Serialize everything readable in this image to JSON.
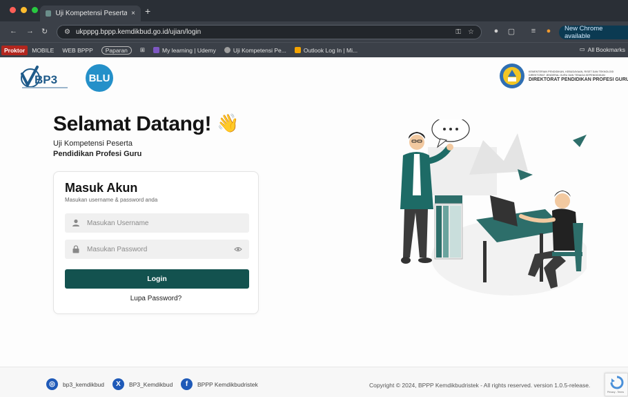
{
  "browser": {
    "tab_title": "Uji Kompetensi Peserta PPG",
    "tab_close": "×",
    "new_tab": "+",
    "url": "ukpppg.bppp.kemdikbud.go.id/ujian/login",
    "new_chrome": "New Chrome available",
    "all_bookmarks": "All Bookmarks",
    "bookmarks": [
      {
        "label": "Proktor",
        "style": "red"
      },
      {
        "label": "MOBILE",
        "style": "plain"
      },
      {
        "label": "WEB BPPP",
        "style": "plain"
      },
      {
        "label": "Paparan",
        "style": "pill"
      },
      {
        "label": "My learning | Udemy",
        "style": "icon",
        "color": "#7e57c2"
      },
      {
        "label": "Uji Kompetensi Pe...",
        "style": "icon",
        "color": "#9e9e9e"
      },
      {
        "label": "Outlook Log In | Mi...",
        "style": "icon",
        "color": "#f4a300"
      }
    ]
  },
  "header": {
    "bp3_text": "BP3",
    "blu_text": "BLU",
    "kemdik_line1": "KEMENTERIAN PENDIDIKAN, KEBUDAYAAN, RISET DAN TEKNOLOGI",
    "kemdik_line2": "DIREKTORAT JENDERAL GURU DAN TENAGA KEPENDIDIKAN",
    "kemdik_line3": "DIREKTORAT PENDIDIKAN PROFESI GURU"
  },
  "hero": {
    "welcome": "Selamat Datang!",
    "wave": "👋",
    "subtitle1": "Uji Kompetensi Peserta",
    "subtitle2": "Pendidikan Profesi Guru"
  },
  "login": {
    "title": "Masuk Akun",
    "hint": "Masukan username & password anda",
    "username_placeholder": "Masukan Username",
    "password_placeholder": "Masukan Password",
    "login_label": "Login",
    "forgot_label": "Lupa Password?"
  },
  "footer": {
    "instagram": "bp3_kemdikbud",
    "x": "BP3_Kemdikbud",
    "facebook": "BPPP Kemdikbudristek",
    "copyright": "Copyright © 2024, BPPP Kemdikbudristek - All rights reserved. version 1.0.5-release.",
    "recaptcha": "Privacy - Terms"
  },
  "colors": {
    "primary": "#13524f",
    "blu": "#2490c9"
  }
}
